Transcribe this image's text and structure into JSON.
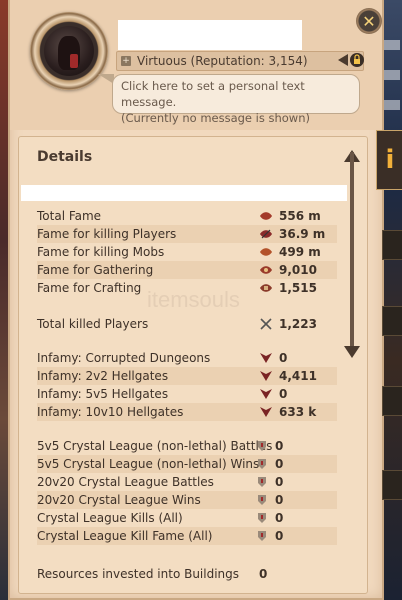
{
  "header": {
    "close_label": "✕",
    "reputation_text": "Virtuous (Reputation: 3,154)",
    "message_line1": "Click here to set a personal text message.",
    "message_line2": "(Currently no message is shown)"
  },
  "details": {
    "title": "Details",
    "side_tab_label": "i",
    "watermark": "itemsouls",
    "fame_rows": [
      {
        "label": "Total Fame",
        "value": "556 m",
        "icon": "fame-icon"
      },
      {
        "label": "Fame for killing Players",
        "value": "36.9 m",
        "icon": "pvp-fame-icon"
      },
      {
        "label": "Fame for killing Mobs",
        "value": "499 m",
        "icon": "pve-fame-icon"
      },
      {
        "label": "Fame for Gathering",
        "value": "9,010",
        "icon": "gathering-icon"
      },
      {
        "label": "Fame for Crafting",
        "value": "1,515",
        "icon": "crafting-icon"
      }
    ],
    "kills_row": {
      "label": "Total killed Players",
      "value": "1,223",
      "icon": "crossed-swords-icon"
    },
    "infamy_rows": [
      {
        "label": "Infamy: Corrupted Dungeons",
        "value": "0"
      },
      {
        "label": "Infamy: 2v2 Hellgates",
        "value": "4,411"
      },
      {
        "label": "Infamy: 5v5 Hellgates",
        "value": "0"
      },
      {
        "label": "Infamy: 10v10 Hellgates",
        "value": "633 k"
      }
    ],
    "crystal_rows": [
      {
        "label": "5v5 Crystal League (non-lethal) Battles",
        "value": "0"
      },
      {
        "label": "5v5 Crystal League (non-lethal) Wins",
        "value": "0"
      },
      {
        "label": "20v20 Crystal League Battles",
        "value": "0"
      },
      {
        "label": "20v20 Crystal League Wins",
        "value": "0"
      },
      {
        "label": "Crystal League Kills (All)",
        "value": "0"
      },
      {
        "label": "Crystal League Kill Fame (All)",
        "value": "0"
      }
    ],
    "buildings_row": {
      "label": "Resources invested into Buildings",
      "value": "0"
    }
  },
  "colors": {
    "parchment": "#f1d9be",
    "text": "#3e3128",
    "accent_gold": "#f2b13a",
    "infamy_red": "#8a2a2a"
  }
}
